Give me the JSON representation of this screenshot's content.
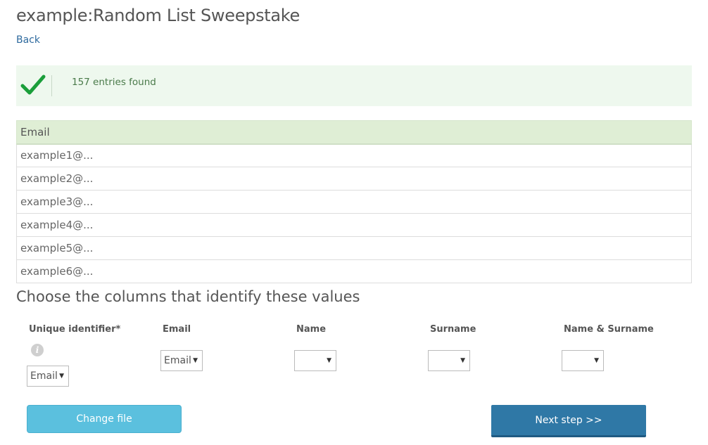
{
  "header": {
    "title": "example:Random List Sweepstake",
    "back_label": "Back"
  },
  "alert": {
    "icon": "check-icon",
    "message": "157 entries found",
    "accent": "#1a9e3a"
  },
  "table": {
    "header": "Email",
    "rows": [
      "example1@...",
      "example2@...",
      "example3@...",
      "example4@...",
      "example5@...",
      "example6@..."
    ]
  },
  "mapping": {
    "title": "Choose the columns that identify these values",
    "columns": [
      {
        "label": "Unique identifier*",
        "value": "Email",
        "has_info": true
      },
      {
        "label": "Email",
        "value": "Email"
      },
      {
        "label": "Name",
        "value": ""
      },
      {
        "label": "Surname",
        "value": ""
      },
      {
        "label": "Name & Surname",
        "value": ""
      }
    ]
  },
  "buttons": {
    "change_file": "Change file",
    "next_step": "Next step >>"
  },
  "colors": {
    "change_button": "#5bc0de",
    "next_button": "#2f78a6",
    "link": "#2e6a9e"
  }
}
